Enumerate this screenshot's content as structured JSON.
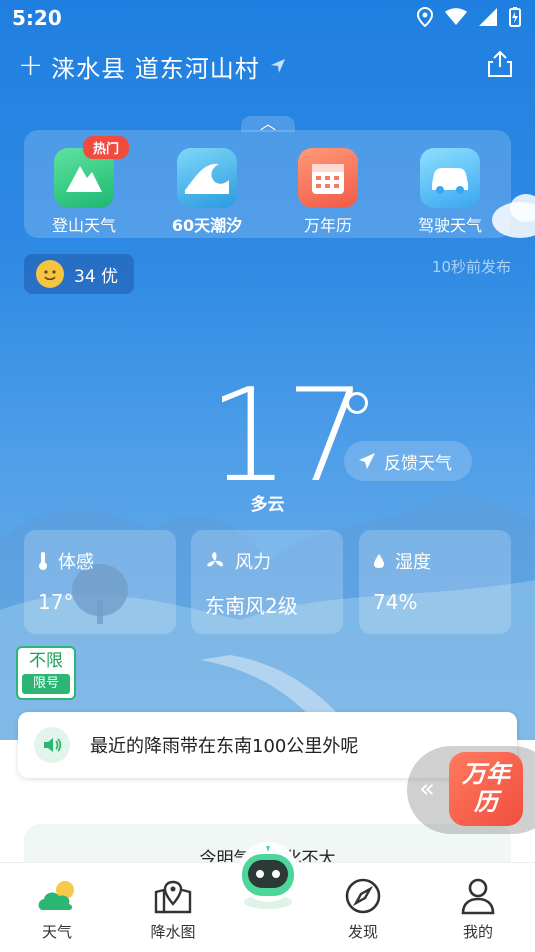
{
  "status_bar": {
    "time": "5:20"
  },
  "location": {
    "name": "涞水县 道东河山村"
  },
  "tools": [
    {
      "label": "登山天气",
      "tag": "热门"
    },
    {
      "label": "60天潮汐"
    },
    {
      "label": "万年历"
    },
    {
      "label": "驾驶天气"
    }
  ],
  "aqi": {
    "text": "34 优"
  },
  "updated": "10秒前发布",
  "weather": {
    "temperature": "17",
    "condition": "多云",
    "feedback_label": "反馈天气"
  },
  "details": [
    {
      "title": "体感",
      "value": "17°"
    },
    {
      "title": "风力",
      "value": "东南风2级"
    },
    {
      "title": "湿度",
      "value": "74%"
    }
  ],
  "restriction": {
    "line1": "不限",
    "line2": "限号"
  },
  "rain_notice": "最近的降雨带在东南100公里外呢",
  "calendar_badge": {
    "line1": "万年",
    "line2": "历"
  },
  "next_card_text": "今明气温变化不大",
  "tabbar": [
    {
      "label": "天气"
    },
    {
      "label": "降水图"
    },
    {
      "label": "发现"
    },
    {
      "label": "我的"
    }
  ],
  "colors": {
    "accent_green": "#2bb673",
    "sky_blue": "#2f8ae4"
  }
}
